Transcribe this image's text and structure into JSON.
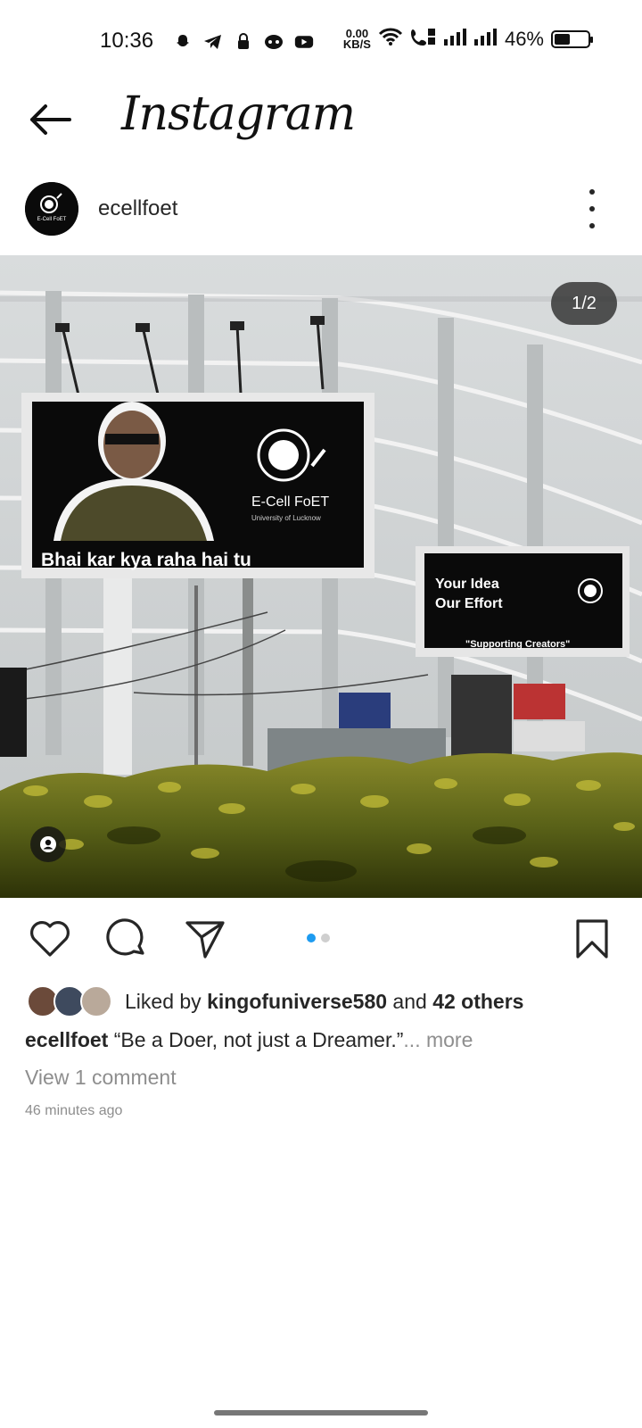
{
  "status_bar": {
    "time": "10:36",
    "speed_value": "0.00",
    "speed_unit": "KB/S",
    "battery_percent": "46%",
    "battery_level": 0.46,
    "icons": [
      "snapchat-icon",
      "telegram-icon",
      "lock-icon",
      "chat-icon",
      "youtube-icon",
      "wifi-icon",
      "volte-call-icon",
      "signal-icon",
      "signal-icon",
      "battery-icon"
    ]
  },
  "app_bar": {
    "title": "Instagram"
  },
  "post": {
    "username": "ecellfoet",
    "avatar_text": "E-Cell FoET",
    "media_counter": "1/2",
    "media": {
      "billboard_1_caption": "Bhai kar kya raha hai tu",
      "billboard_1_logo_title": "E-Cell FoET",
      "billboard_1_logo_subtitle": "University of Lucknow",
      "billboard_2_line1": "Your Idea",
      "billboard_2_line2": "Our Effort",
      "billboard_2_line3": "\"Supporting Creators\""
    },
    "carousel": {
      "total": 2,
      "current": 1
    },
    "likes": {
      "prefix": "Liked by ",
      "first_user": "kingofuniverse580",
      "joiner": " and ",
      "others": "42 others"
    },
    "caption": {
      "username": "ecellfoet",
      "text": "“Be a Doer, not just a Dreamer.”",
      "more": "... more"
    },
    "view_comments": "View 1 comment",
    "timestamp": "46 minutes ago"
  },
  "colors": {
    "accent": "#1d9bf0",
    "text": "#262626",
    "secondary_text": "#8e8e8e"
  }
}
